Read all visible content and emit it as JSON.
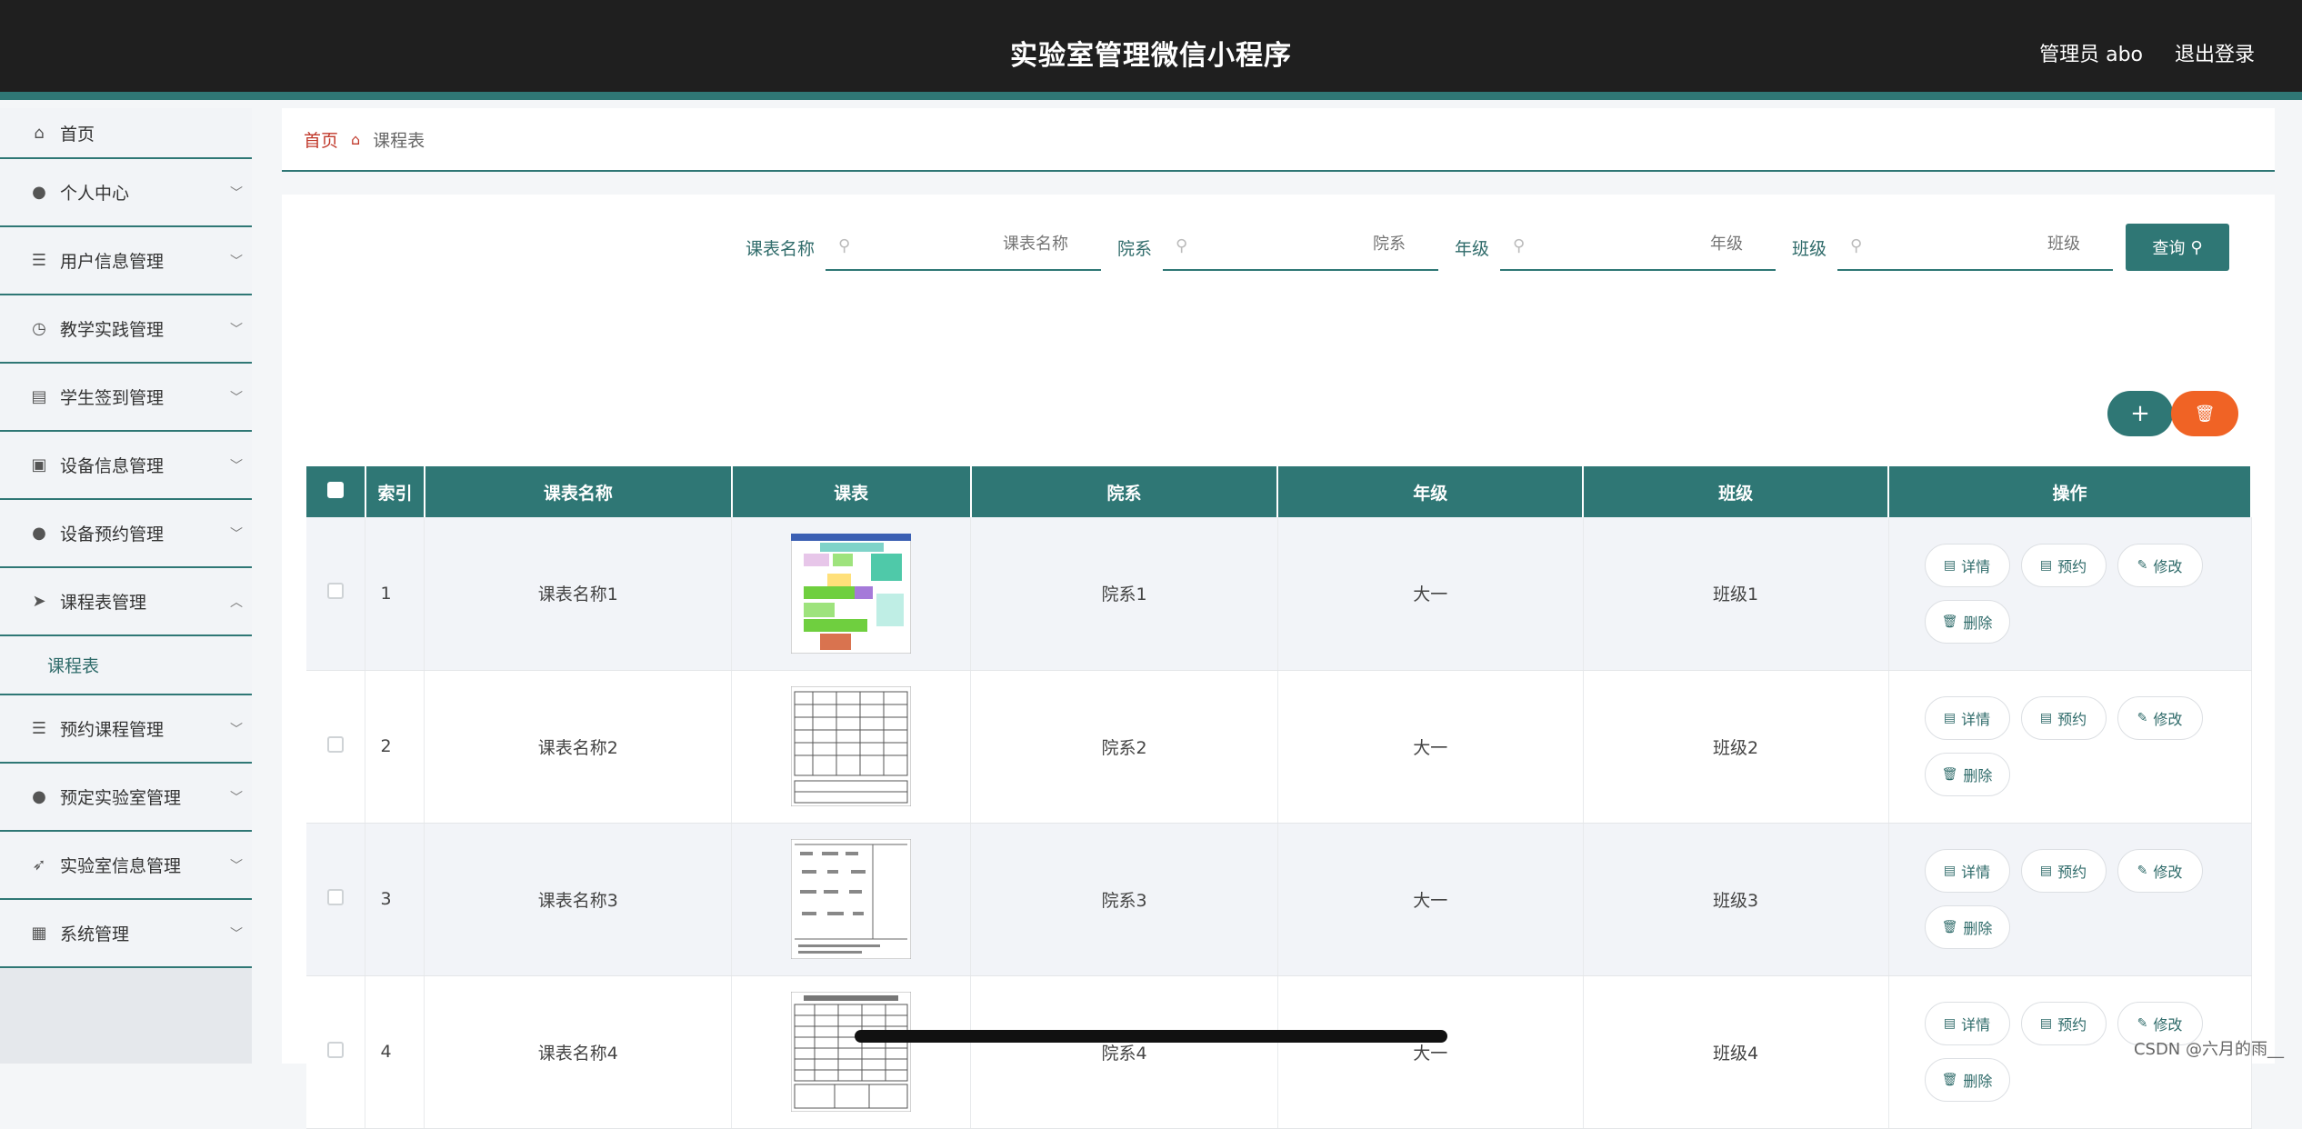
{
  "header": {
    "title": "实验室管理微信小程序",
    "user": "管理员 abo",
    "logout": "退出登录"
  },
  "sidebar": {
    "items": [
      {
        "label": "首页",
        "icon": "home-icon",
        "glyph": "⌂"
      },
      {
        "label": "个人中心",
        "icon": "user-icon",
        "glyph": "●"
      },
      {
        "label": "用户信息管理",
        "icon": "list-icon",
        "glyph": "☰"
      },
      {
        "label": "教学实践管理",
        "icon": "clock-icon",
        "glyph": "◷"
      },
      {
        "label": "学生签到管理",
        "icon": "printer-icon",
        "glyph": "▤"
      },
      {
        "label": "设备信息管理",
        "icon": "chat-icon",
        "glyph": "▣"
      },
      {
        "label": "设备预约管理",
        "icon": "user-icon",
        "glyph": "●"
      },
      {
        "label": "课程表管理",
        "icon": "send-icon",
        "glyph": "➤"
      },
      {
        "label": "预约课程管理",
        "icon": "list-icon",
        "glyph": "☰"
      },
      {
        "label": "预定实验室管理",
        "icon": "user-icon",
        "glyph": "●"
      },
      {
        "label": "实验室信息管理",
        "icon": "navigate-icon",
        "glyph": "➶"
      },
      {
        "label": "系统管理",
        "icon": "grid-icon",
        "glyph": "▦"
      }
    ],
    "submenu": "课程表"
  },
  "breadcrumb": {
    "home": "首页",
    "current": "课程表"
  },
  "filters": [
    {
      "label": "课表名称",
      "placeholder": "课表名称"
    },
    {
      "label": "院系",
      "placeholder": "院系"
    },
    {
      "label": "年级",
      "placeholder": "年级"
    },
    {
      "label": "班级",
      "placeholder": "班级"
    }
  ],
  "query_label": "查询",
  "add_label": "+",
  "table": {
    "headers": [
      "索引",
      "课表名称",
      "课表",
      "院系",
      "年级",
      "班级",
      "操作"
    ],
    "rows": [
      {
        "idx": "1",
        "name": "课表名称1",
        "dept": "院系1",
        "grade": "大一",
        "cls": "班级1"
      },
      {
        "idx": "2",
        "name": "课表名称2",
        "dept": "院系2",
        "grade": "大一",
        "cls": "班级2"
      },
      {
        "idx": "3",
        "name": "课表名称3",
        "dept": "院系3",
        "grade": "大一",
        "cls": "班级3"
      },
      {
        "idx": "4",
        "name": "课表名称4",
        "dept": "院系4",
        "grade": "大一",
        "cls": "班级4"
      }
    ],
    "actions": {
      "detail": "详情",
      "reserve": "预约",
      "edit": "修改",
      "delete": "删除"
    }
  },
  "watermark": "CSDN @六月的雨__"
}
